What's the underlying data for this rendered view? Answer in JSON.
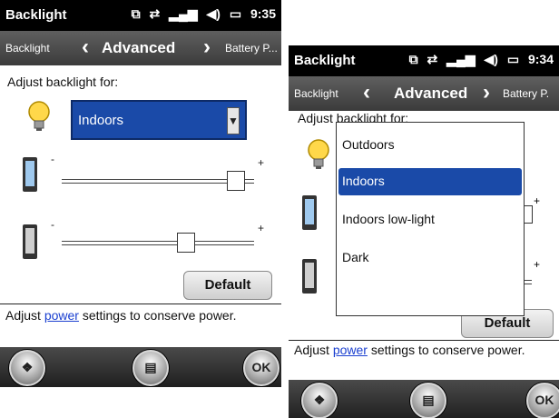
{
  "screens": [
    {
      "status": {
        "title": "Backlight",
        "time": "9:35"
      },
      "tabs": {
        "prev": "Backlight",
        "current": "Advanced",
        "next": "Battery P..."
      },
      "adjust_label": "Adjust backlight for:",
      "profile_select": {
        "value": "Indoors",
        "button_glyph": "▼"
      },
      "slider_min_label": "-",
      "slider_max_label": "+",
      "brightness_level_screen_pct": 95,
      "brightness_level_keypad_pct": 66,
      "default_button": "Default",
      "power_text_before": "Adjust ",
      "power_link": "power",
      "power_text_after": " settings to conserve power.",
      "softkeys": {
        "left": "start-icon",
        "center": "keyboard-icon",
        "right": "OK"
      }
    },
    {
      "status": {
        "title": "Backlight",
        "time": "9:34"
      },
      "tabs": {
        "prev": "Backlight",
        "current": "Advanced",
        "next": "Battery P."
      },
      "adjust_label": "Adjust backlight for:",
      "default_button": "Default",
      "power_text_before": "Adjust ",
      "power_link": "power",
      "power_text_after": " settings to conserve power.",
      "softkeys": {
        "left": "start-icon",
        "center": "keyboard-icon",
        "right": "OK"
      },
      "dropdown_options": [
        "Outdoors",
        "Indoors",
        "Indoors low-light",
        "Dark"
      ],
      "dropdown_selected": "Indoors"
    }
  ],
  "colors": {
    "selection": "#1a4aa8",
    "link": "#1a3fd0",
    "statusbar": "#000000"
  }
}
